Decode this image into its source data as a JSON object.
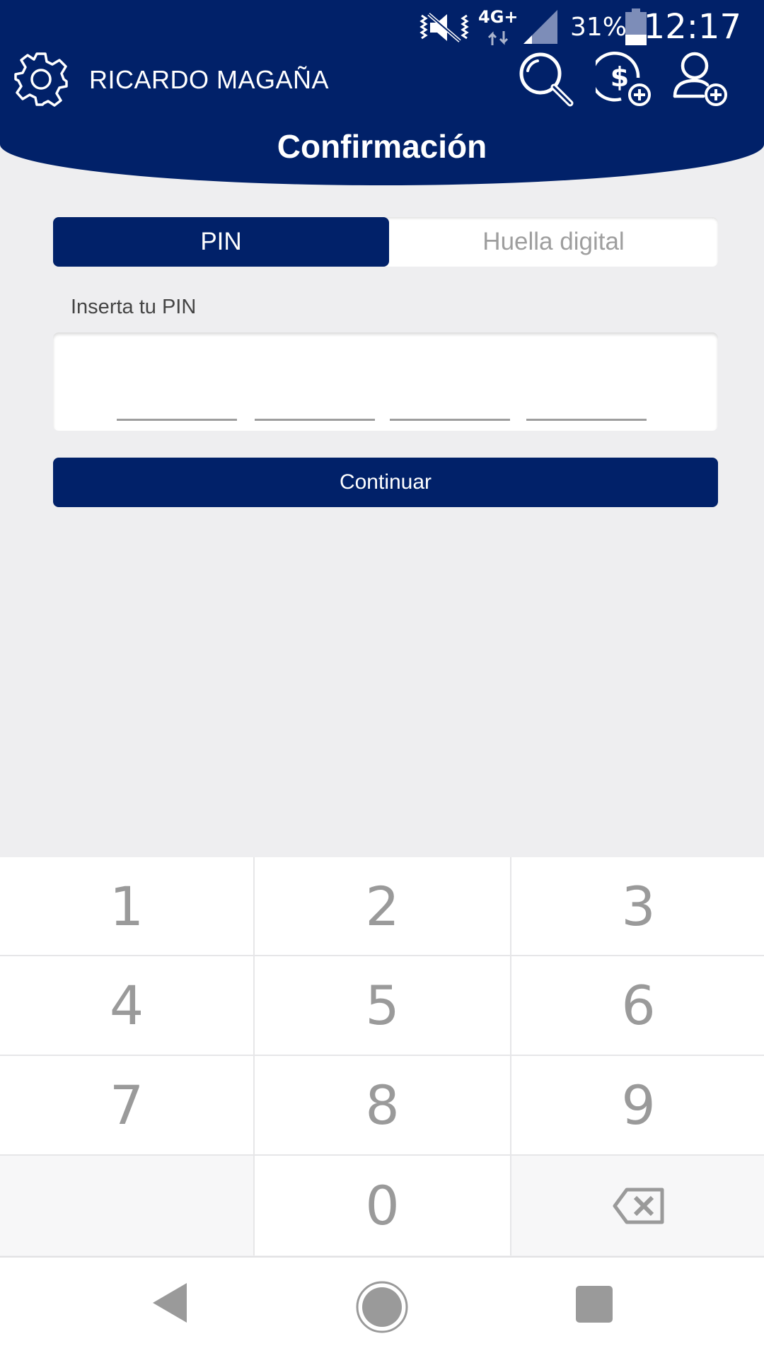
{
  "status_bar": {
    "network": "4G+",
    "battery_percent": "31%",
    "time": "12:17",
    "icons": [
      "vibrate-off-icon",
      "data-arrows-icon",
      "signal-icon",
      "battery-icon"
    ]
  },
  "top_bar": {
    "user_name": "RICARDO MAGAÑA",
    "icons": [
      "settings-gear-icon",
      "search-icon",
      "add-payment-icon",
      "add-contact-icon"
    ]
  },
  "page": {
    "title": "Confirmación"
  },
  "auth_tabs": {
    "items": [
      {
        "label": "PIN",
        "active": true
      },
      {
        "label": "Huella digital",
        "active": false
      }
    ]
  },
  "pin": {
    "label": "Inserta tu PIN",
    "digits_entered": 0,
    "slots": 4
  },
  "actions": {
    "continue_label": "Continuar"
  },
  "keypad": {
    "keys": [
      "1",
      "2",
      "3",
      "4",
      "5",
      "6",
      "7",
      "8",
      "9",
      "",
      "0",
      "backspace-icon"
    ]
  },
  "nav_bar": {
    "icons": [
      "back-icon",
      "home-icon",
      "recents-icon"
    ]
  },
  "colors": {
    "brand": "#012169",
    "background": "#eeeef0",
    "key_text": "#9a9a9a",
    "inactive_tab_text": "#9e9e9e"
  }
}
